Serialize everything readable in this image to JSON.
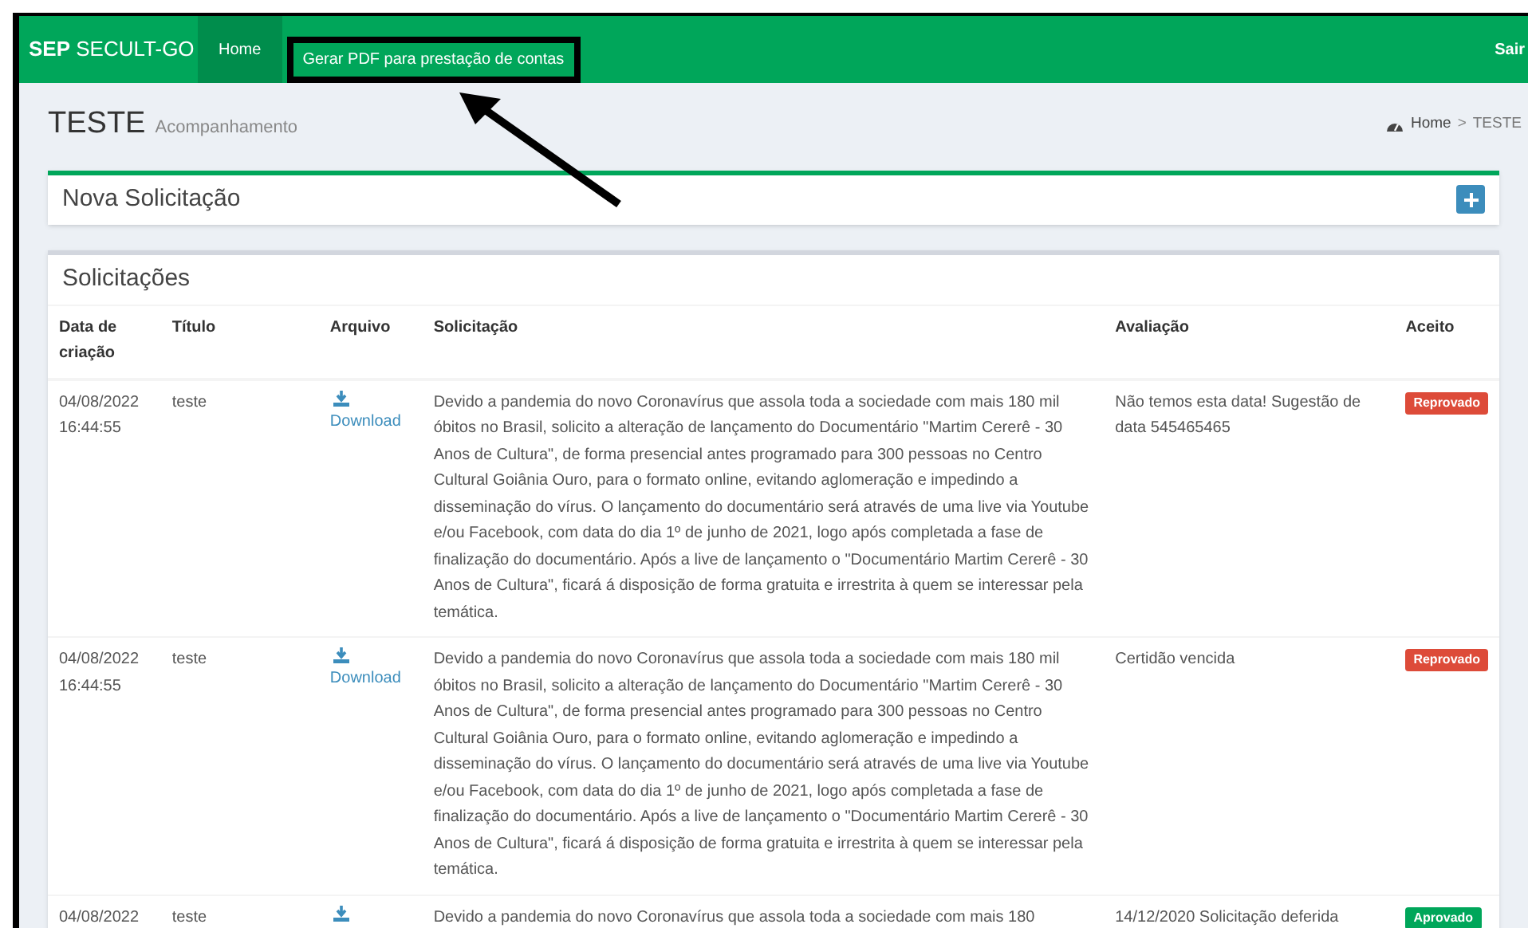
{
  "navbar": {
    "brand": "**SEP** SECULT-GO",
    "items": [
      {
        "label": "Home",
        "selected": true
      },
      {
        "label": "Gerar PDF para prestação de contas",
        "selected": false
      }
    ],
    "logout": "Sair"
  },
  "header": {
    "title": "TESTE",
    "subtitle": "Acompanhamento",
    "breadcrumb": [
      "Home",
      ">",
      "TESTE"
    ]
  },
  "new_request": {
    "title": "Nova Solicitação"
  },
  "requests": {
    "title": "Solicitações",
    "columns": [
      "Data de criação",
      "Título",
      "Arquivo",
      "Solicitação",
      "Avaliação",
      "Aceito"
    ],
    "rows": [
      {
        "date": "04/08/2022 16:44:55",
        "title": "teste",
        "file": "Download",
        "request": "Devido a pandemia do novo Coronavírus que assola toda a sociedade com mais 180 mil óbitos no Brasil, solicito a alteração de lançamento do Documentário \"Martim Cererê - 30 Anos de Cultura\", de forma presencial antes programado para 300 pessoas no Centro Cultural Goiânia Ouro, para o formato online, evitando aglomeração e impedindo a disseminação do vírus. O lançamento do documentário será através de uma live via Youtube e/ou Facebook, com data do dia 1º de junho de 2021, logo após completada a fase de finalização do documentário. Após a live de lançamento o \"Documentário Martim Cererê - 30 Anos de Cultura\", ficará á disposição de forma gratuita e irrestrita à quem se interessar pela temática.",
        "evaluation": "Não temos esta data! Sugestão de data 545465465",
        "status": "Reprovado",
        "accepted": false
      },
      {
        "date": "04/08/2022 16:44:55",
        "title": "teste",
        "file": "Download",
        "request": "Devido a pandemia do novo Coronavírus que assola toda a sociedade com mais 180 mil óbitos no Brasil, solicito a alteração de lançamento do Documentário \"Martim Cererê - 30 Anos de Cultura\", de forma presencial antes programado para 300 pessoas no Centro Cultural Goiânia Ouro, para o formato online, evitando aglomeração e impedindo a disseminação do vírus. O lançamento do documentário será através de uma live via Youtube e/ou Facebook, com data do dia 1º de junho de 2021, logo após completada a fase de finalização do documentário. Após a live de lançamento o \"Documentário Martim Cererê - 30 Anos de Cultura\", ficará á disposição de forma gratuita e irrestrita à quem se interessar pela temática.",
        "evaluation": "Certidão vencida",
        "status": "Reprovado",
        "accepted": false
      },
      {
        "date": "04/08/2022",
        "title": "teste",
        "file": "",
        "request": "Devido a pandemia do novo Coronavírus que assola toda a sociedade com mais 180",
        "evaluation": "14/12/2020 Solicitação deferida",
        "status": "Aprovado",
        "accepted": true
      }
    ]
  }
}
